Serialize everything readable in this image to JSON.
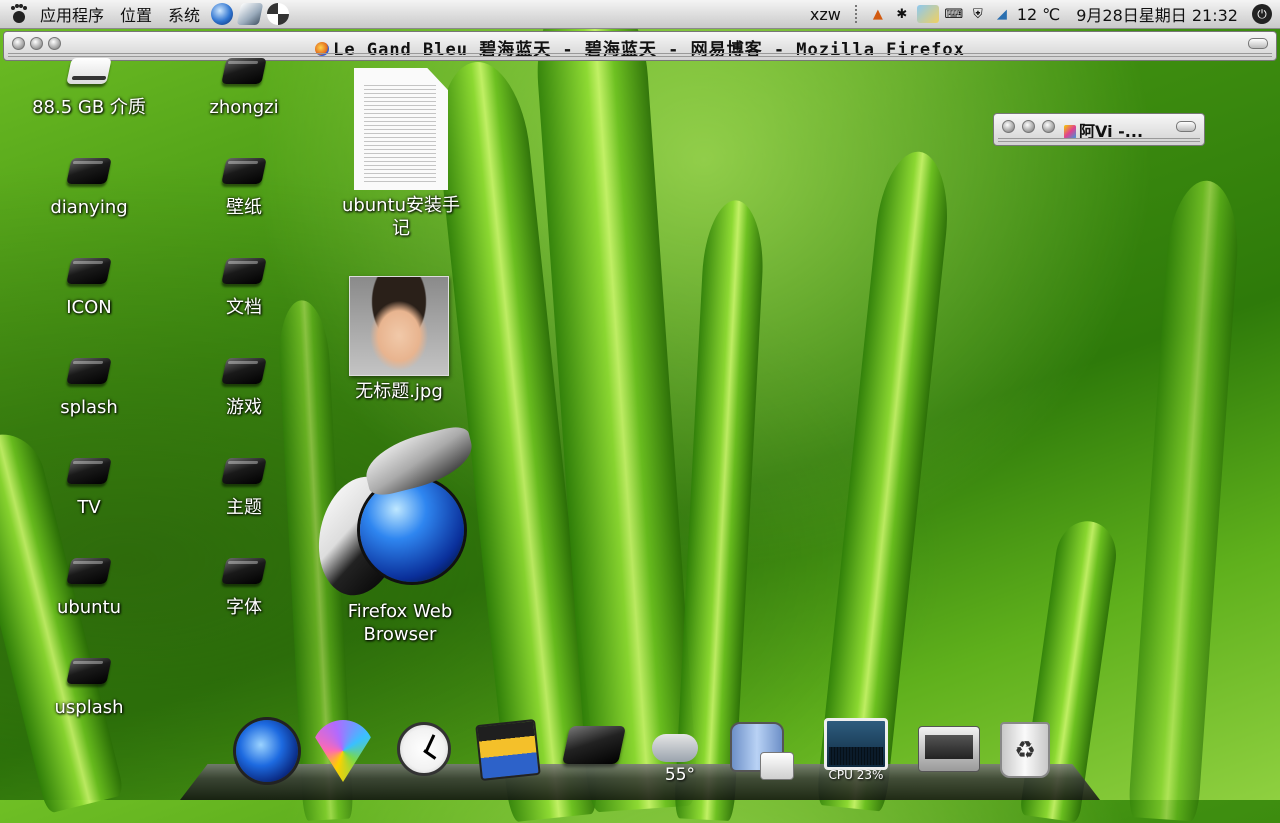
{
  "top_panel": {
    "menus": [
      "应用程序",
      "位置",
      "系统"
    ],
    "username": "xzw",
    "weather": "12 ℃",
    "datetime": "9月28日星期日 21:32"
  },
  "firefox_window": {
    "title": "Le Gand Bleu 碧海蓝天 - 碧海蓝天 - 网易博客 - Mozilla Firefox"
  },
  "mini_window": {
    "title": "阿Vi -..."
  },
  "desktop_icons": {
    "col1": [
      "88.5 GB 介质",
      "dianying",
      "ICON",
      "splash",
      "TV",
      "ubuntu",
      "usplash"
    ],
    "col2": [
      "zhongzi",
      "壁纸",
      "文档",
      "游戏",
      "主题",
      "字体"
    ],
    "document": "ubuntu安装手记",
    "image": "无标题.jpg",
    "firefox": "Firefox Web Browser"
  },
  "dock": {
    "weather_temp": "55°",
    "cpu_label": "CPU 23%"
  }
}
